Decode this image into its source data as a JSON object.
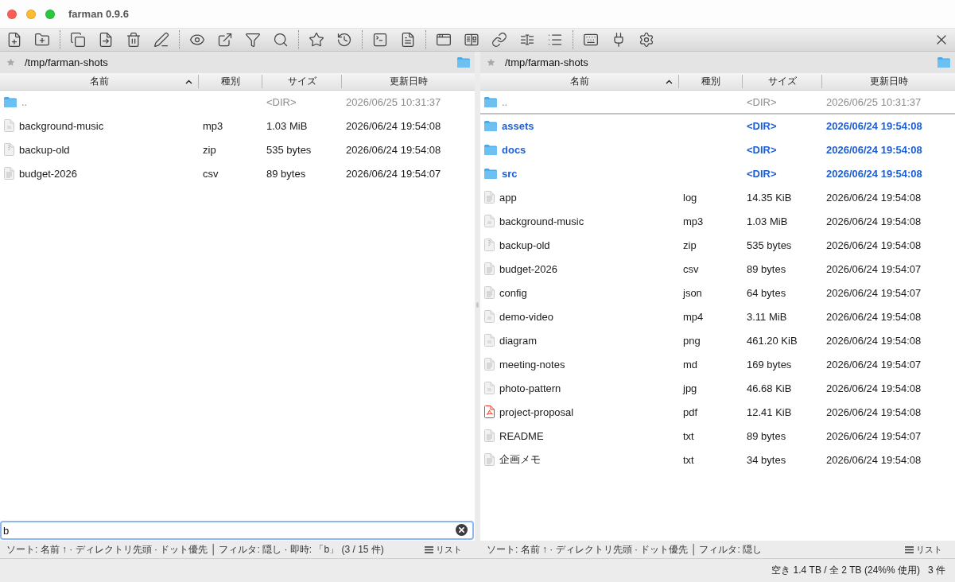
{
  "window": {
    "title": "farman 0.9.6"
  },
  "panels": [
    {
      "path": "/tmp/farman-shots",
      "columns": [
        {
          "label": "名前",
          "sorted": true
        },
        {
          "label": "種別",
          "sorted": false
        },
        {
          "label": "サイズ",
          "sorted": false
        },
        {
          "label": "更新日時",
          "sorted": false
        }
      ],
      "rows": [
        {
          "kind": "parent",
          "name": "..",
          "size": "<DIR>",
          "modified": "2026/06/25 10:31:37",
          "cursor": false
        },
        {
          "kind": "media",
          "name": "background-music",
          "type": "mp3",
          "size": "1.03 MiB",
          "modified": "2026/06/24 19:54:08",
          "cursor": false
        },
        {
          "kind": "archive",
          "name": "backup-old",
          "type": "zip",
          "size": "535 bytes",
          "modified": "2026/06/24 19:54:08",
          "cursor": false
        },
        {
          "kind": "text",
          "name": "budget-2026",
          "type": "csv",
          "size": "89 bytes",
          "modified": "2026/06/24 19:54:07",
          "cursor": false
        }
      ],
      "filter": {
        "value": "b"
      },
      "status": {
        "text": "ソート: 名前 ↑ · ディレクトリ先頭 · ドット優先 │ フィルタ: 隠し · 即時: 「b」 (3 / 15 件)",
        "view_mode": "リスト"
      }
    },
    {
      "path": "/tmp/farman-shots",
      "columns": [
        {
          "label": "名前",
          "sorted": true
        },
        {
          "label": "種別",
          "sorted": false
        },
        {
          "label": "サイズ",
          "sorted": false
        },
        {
          "label": "更新日時",
          "sorted": false
        }
      ],
      "rows": [
        {
          "kind": "parent",
          "name": "..",
          "size": "<DIR>",
          "modified": "2026/06/25 10:31:37",
          "cursor": true
        },
        {
          "kind": "dir",
          "name": "assets",
          "size": "<DIR>",
          "modified": "2026/06/24 19:54:08",
          "cursor": false
        },
        {
          "kind": "dir",
          "name": "docs",
          "size": "<DIR>",
          "modified": "2026/06/24 19:54:08",
          "cursor": false
        },
        {
          "kind": "dir",
          "name": "src",
          "size": "<DIR>",
          "modified": "2026/06/24 19:54:08",
          "cursor": false
        },
        {
          "kind": "text",
          "name": "app",
          "type": "log",
          "size": "14.35 KiB",
          "modified": "2026/06/24 19:54:08",
          "cursor": false
        },
        {
          "kind": "media",
          "name": "background-music",
          "type": "mp3",
          "size": "1.03 MiB",
          "modified": "2026/06/24 19:54:08",
          "cursor": false
        },
        {
          "kind": "archive",
          "name": "backup-old",
          "type": "zip",
          "size": "535 bytes",
          "modified": "2026/06/24 19:54:08",
          "cursor": false
        },
        {
          "kind": "text",
          "name": "budget-2026",
          "type": "csv",
          "size": "89 bytes",
          "modified": "2026/06/24 19:54:07",
          "cursor": false
        },
        {
          "kind": "text",
          "name": "config",
          "type": "json",
          "size": "64 bytes",
          "modified": "2026/06/24 19:54:07",
          "cursor": false
        },
        {
          "kind": "media",
          "name": "demo-video",
          "type": "mp4",
          "size": "3.11 MiB",
          "modified": "2026/06/24 19:54:08",
          "cursor": false
        },
        {
          "kind": "media",
          "name": "diagram",
          "type": "png",
          "size": "461.20 KiB",
          "modified": "2026/06/24 19:54:08",
          "cursor": false
        },
        {
          "kind": "text",
          "name": "meeting-notes",
          "type": "md",
          "size": "169 bytes",
          "modified": "2026/06/24 19:54:07",
          "cursor": false
        },
        {
          "kind": "media",
          "name": "photo-pattern",
          "type": "jpg",
          "size": "46.68 KiB",
          "modified": "2026/06/24 19:54:08",
          "cursor": false
        },
        {
          "kind": "pdf",
          "name": "project-proposal",
          "type": "pdf",
          "size": "12.41 KiB",
          "modified": "2026/06/24 19:54:08",
          "cursor": false
        },
        {
          "kind": "text",
          "name": "README",
          "type": "txt",
          "size": "89 bytes",
          "modified": "2026/06/24 19:54:07",
          "cursor": false
        },
        {
          "kind": "text",
          "name": "企画メモ",
          "type": "txt",
          "size": "34 bytes",
          "modified": "2026/06/24 19:54:08",
          "cursor": false
        }
      ],
      "status": {
        "text": "ソート: 名前 ↑ · ディレクトリ先頭 · ドット優先 │ フィルタ: 隠し",
        "view_mode": "リスト"
      }
    }
  ],
  "status_bar": {
    "disk": "空き 1.4 TB / 全 2 TB (24%% 使用)",
    "count": "3 件"
  }
}
